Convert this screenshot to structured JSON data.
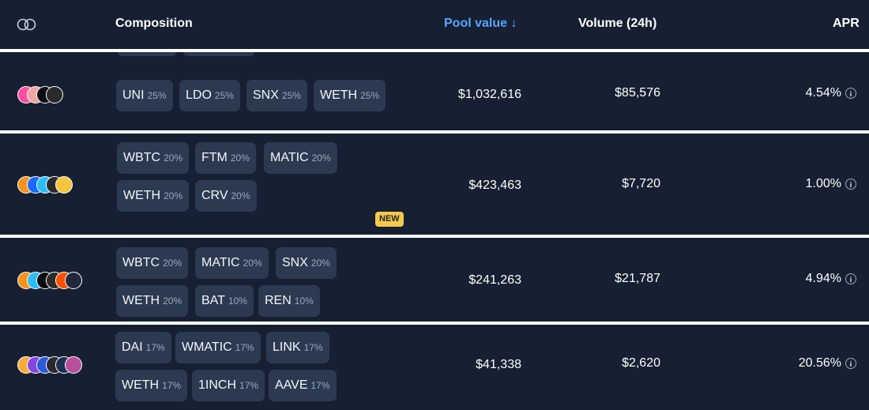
{
  "header": {
    "composition": "Composition",
    "pool_value": "Pool value ↓",
    "volume": "Volume (24h)",
    "apr": "APR"
  },
  "colors": {
    "background": "#162032",
    "chip": "#2b3a50",
    "accent_blue": "#5aa2ff",
    "new_badge": "#f6c94a"
  },
  "rows": [
    {
      "tokens": [
        {
          "symbol": "UNI",
          "weight": "25%"
        },
        {
          "symbol": "LDO",
          "weight": "25%"
        },
        {
          "symbol": "SNX",
          "weight": "25%"
        },
        {
          "symbol": "WETH",
          "weight": "25%"
        }
      ],
      "pool_value": "$1,032,616",
      "volume": "$85,576",
      "apr": "4.54%"
    },
    {
      "tokens": [
        {
          "symbol": "WBTC",
          "weight": "20%"
        },
        {
          "symbol": "FTM",
          "weight": "20%"
        },
        {
          "symbol": "MATIC",
          "weight": "20%"
        },
        {
          "symbol": "WETH",
          "weight": "20%"
        },
        {
          "symbol": "CRV",
          "weight": "20%"
        }
      ],
      "badge": "NEW",
      "pool_value": "$423,463",
      "volume": "$7,720",
      "apr": "1.00%"
    },
    {
      "tokens": [
        {
          "symbol": "WBTC",
          "weight": "20%"
        },
        {
          "symbol": "MATIC",
          "weight": "20%"
        },
        {
          "symbol": "SNX",
          "weight": "20%"
        },
        {
          "symbol": "WETH",
          "weight": "20%"
        },
        {
          "symbol": "BAT",
          "weight": "10%"
        },
        {
          "symbol": "REN",
          "weight": "10%"
        }
      ],
      "pool_value": "$241,263",
      "volume": "$21,787",
      "apr": "4.94%"
    },
    {
      "tokens": [
        {
          "symbol": "DAI",
          "weight": "17%"
        },
        {
          "symbol": "WMATIC",
          "weight": "17%"
        },
        {
          "symbol": "LINK",
          "weight": "17%"
        },
        {
          "symbol": "WETH",
          "weight": "17%"
        },
        {
          "symbol": "1INCH",
          "weight": "17%"
        },
        {
          "symbol": "AAVE",
          "weight": "17%"
        }
      ],
      "pool_value": "$41,338",
      "volume": "$2,620",
      "apr": "20.56%"
    }
  ]
}
